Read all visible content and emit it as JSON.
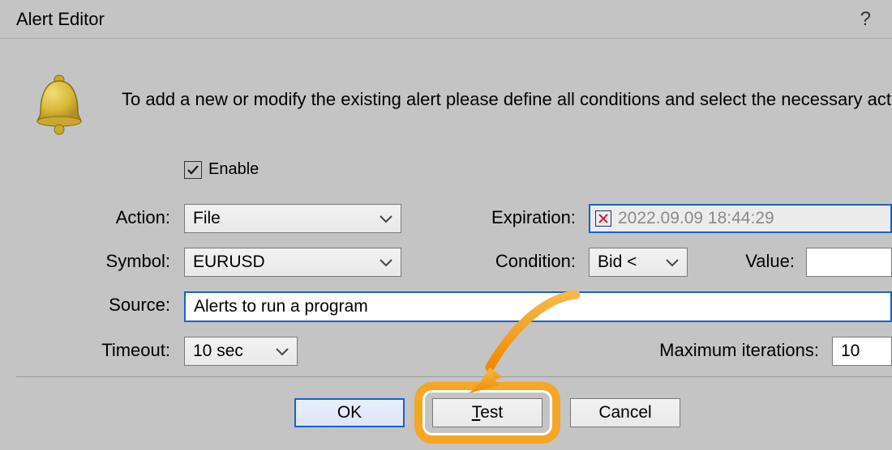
{
  "window": {
    "title": "Alert Editor",
    "help": "?"
  },
  "intro": "To add a new or modify the existing alert please define all conditions and select the necessary act",
  "enable": {
    "label": "Enable",
    "checked": true
  },
  "labels": {
    "action": "Action:",
    "symbol": "Symbol:",
    "source": "Source:",
    "timeout": "Timeout:",
    "expiration": "Expiration:",
    "condition": "Condition:",
    "value": "Value:",
    "max_iter": "Maximum iterations:"
  },
  "fields": {
    "action": "File",
    "symbol": "EURUSD",
    "source": "Alerts to run a program",
    "timeout": "10 sec",
    "expiration": "2022.09.09 18:44:29",
    "condition": "Bid <",
    "value": "",
    "max_iter": "10"
  },
  "buttons": {
    "ok": "OK",
    "test": "Test",
    "cancel": "Cancel"
  }
}
